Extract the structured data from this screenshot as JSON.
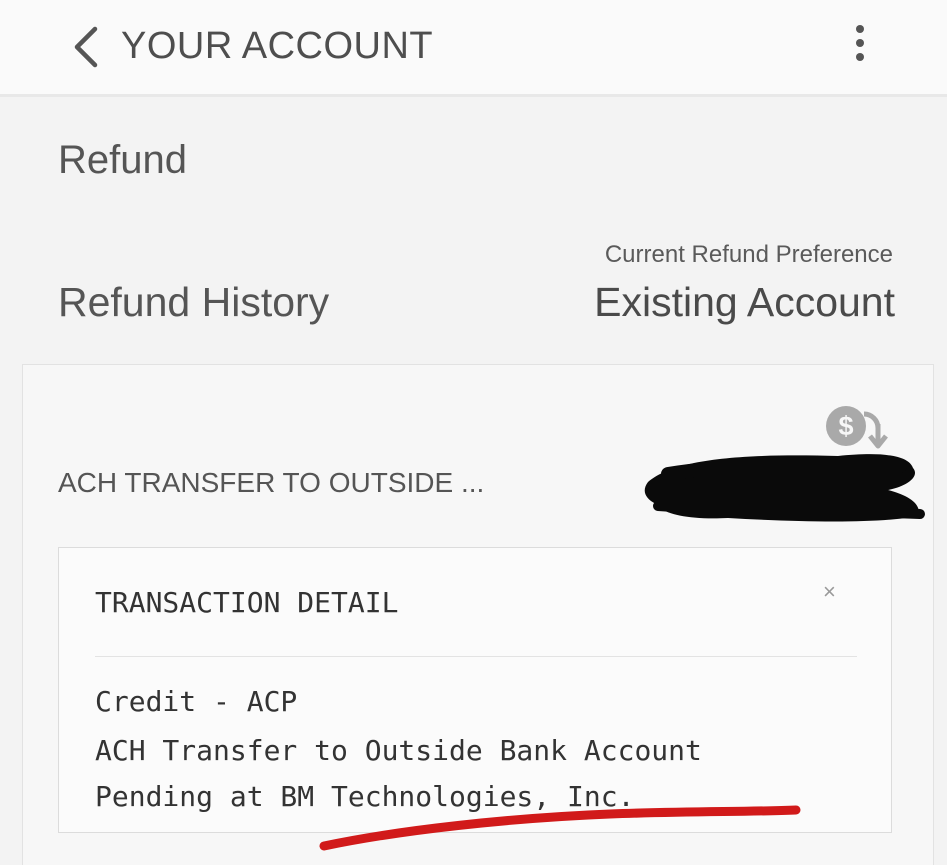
{
  "header": {
    "title": "YOUR ACCOUNT",
    "back_icon": "chevron-left-icon",
    "menu_icon": "more-vertical-icon"
  },
  "page": {
    "title": "Refund"
  },
  "refund_history": {
    "label": "Refund History",
    "preference_caption": "Current Refund Preference",
    "preference_value": "Existing Account"
  },
  "transaction": {
    "label": "ACH TRANSFER TO OUTSIDE ...",
    "icon": "dollar-refund-icon",
    "amount_redacted": true,
    "detail": {
      "title": "TRANSACTION DETAIL",
      "close_label": "×",
      "lines": [
        "Credit - ACP",
        "ACH Transfer to Outside Bank Account",
        "Pending at BM Technologies, Inc."
      ]
    }
  },
  "colors": {
    "redaction": "#0a0a0a",
    "underline_annotation": "#d11a1a",
    "icon_gray": "#a9a9a9"
  }
}
